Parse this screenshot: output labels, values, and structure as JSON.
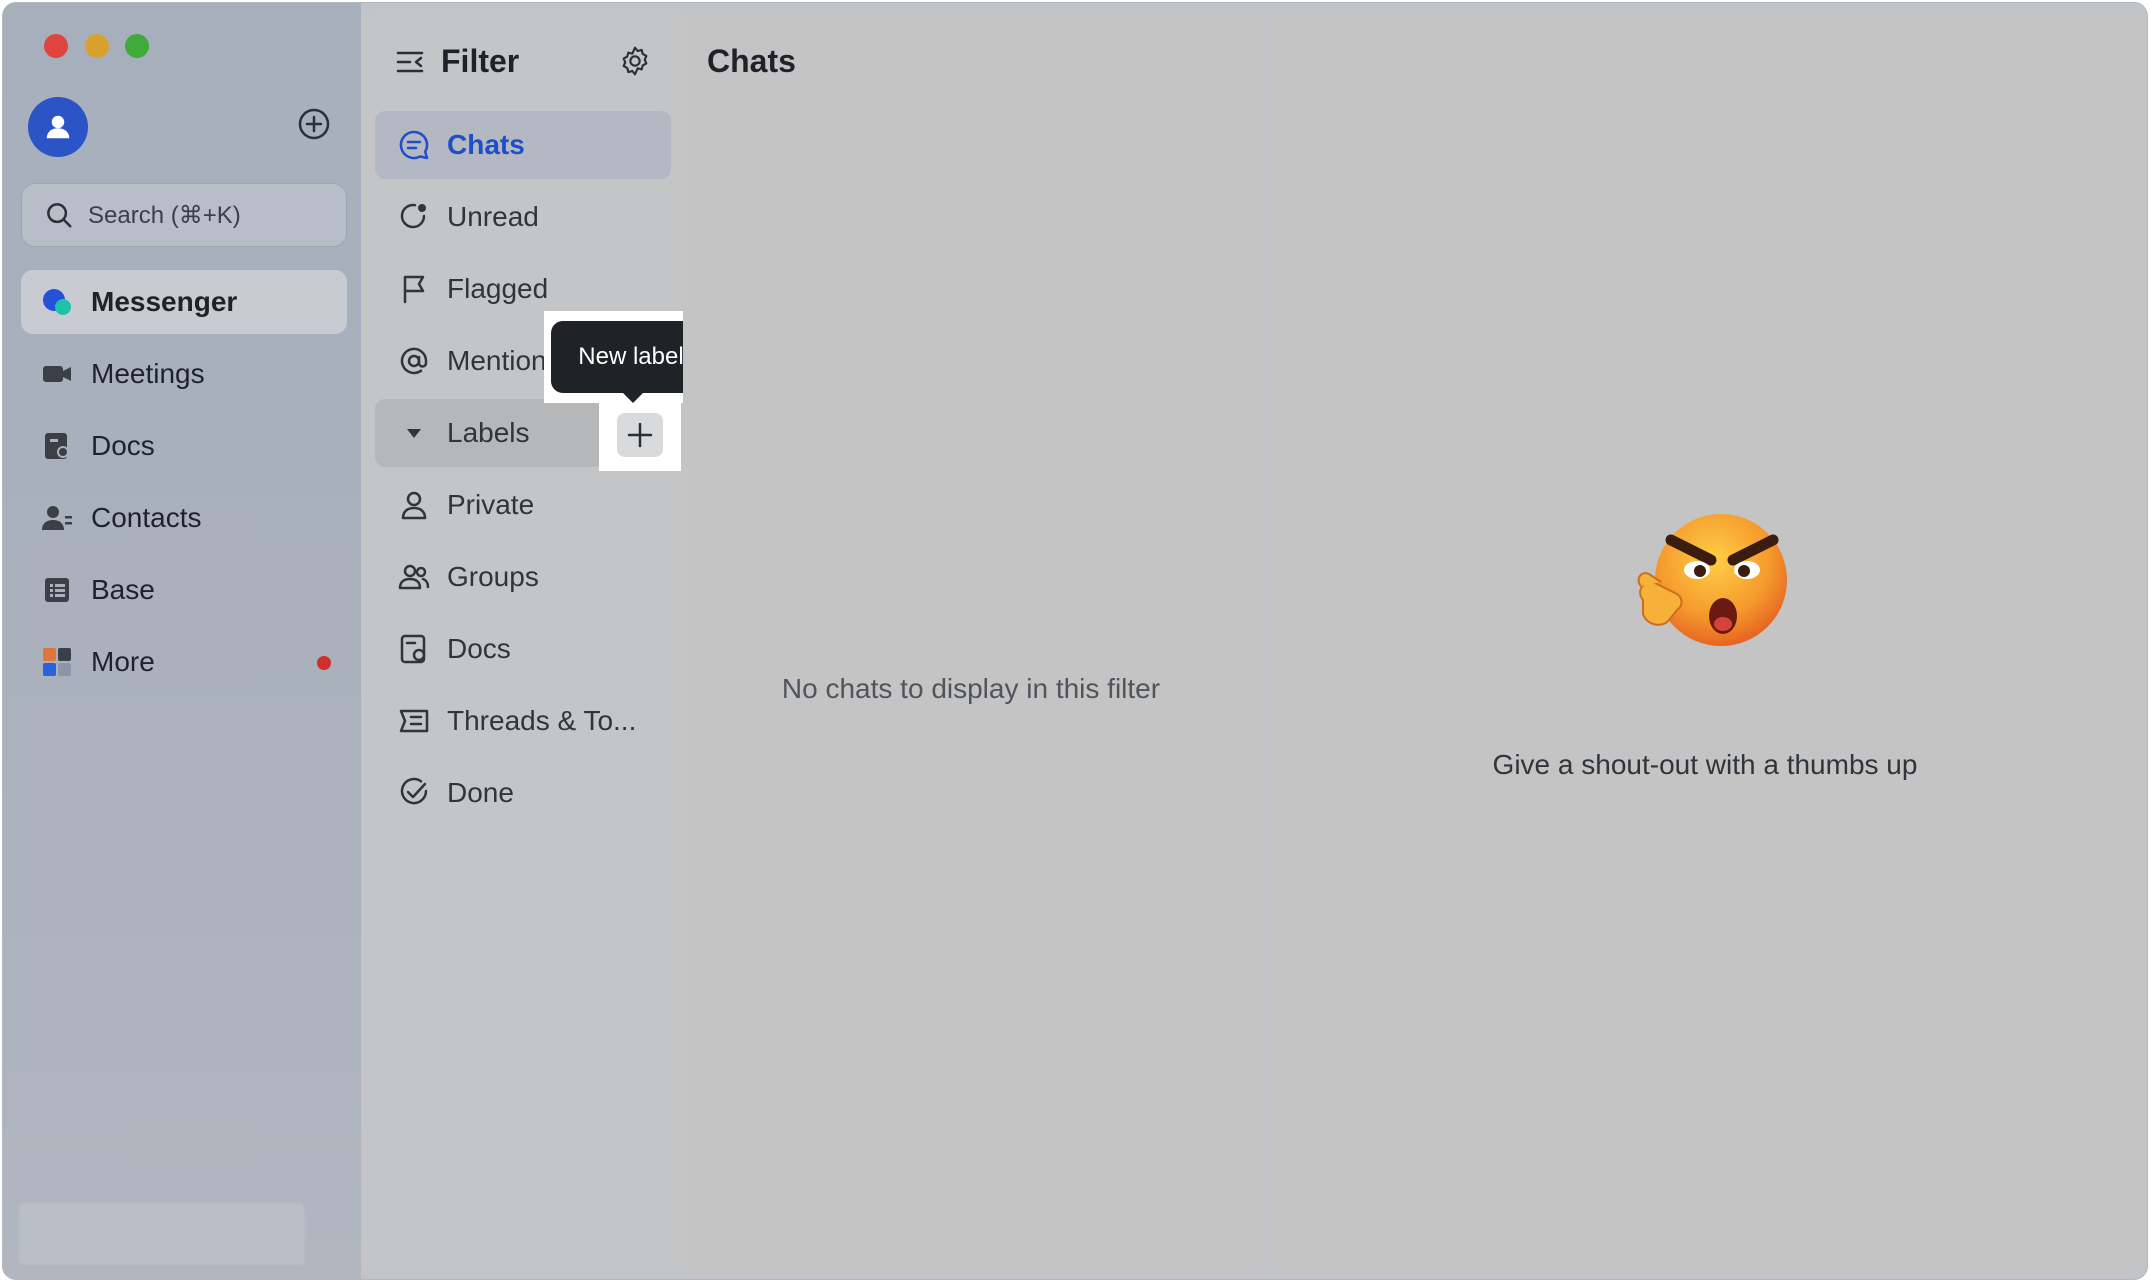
{
  "colors": {
    "accent": "#1f4fc8",
    "avatar_bg": "#2b54c7",
    "notification_dot": "#d0302a",
    "tooltip_bg": "#1f2227"
  },
  "sidebar": {
    "search_placeholder": "Search (⌘+K)",
    "items": [
      {
        "label": "Messenger",
        "icon": "messenger-icon",
        "active": true
      },
      {
        "label": "Meetings",
        "icon": "video-camera-icon"
      },
      {
        "label": "Docs",
        "icon": "docs-icon"
      },
      {
        "label": "Contacts",
        "icon": "contacts-icon"
      },
      {
        "label": "Base",
        "icon": "base-icon"
      },
      {
        "label": "More",
        "icon": "more-apps-icon",
        "has_notification": true
      }
    ]
  },
  "filter": {
    "title": "Filter",
    "items": [
      {
        "label": "Chats",
        "icon": "chat-bubble-icon",
        "active": true
      },
      {
        "label": "Unread",
        "icon": "unread-icon"
      },
      {
        "label": "Flagged",
        "icon": "flag-icon"
      },
      {
        "label": "Mention",
        "icon": "at-icon"
      },
      {
        "label": "Labels",
        "icon": "caret-down-icon"
      },
      {
        "label": "Private",
        "icon": "person-icon"
      },
      {
        "label": "Groups",
        "icon": "groups-icon"
      },
      {
        "label": "Docs",
        "icon": "doc-icon"
      },
      {
        "label": "Threads & To...",
        "icon": "threads-icon"
      },
      {
        "label": "Done",
        "icon": "done-icon"
      }
    ],
    "tooltip": "New label"
  },
  "chats": {
    "title": "Chats",
    "empty_message": "No chats to display in this filter"
  },
  "detail": {
    "message": "Give a shout-out with a thumbs up"
  }
}
